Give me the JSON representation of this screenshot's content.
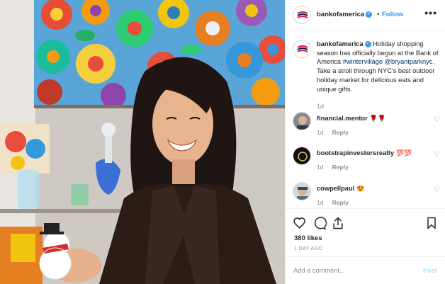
{
  "post": {
    "username": "bankofamerica",
    "follow_label": "Follow",
    "separator": "•",
    "more_label": "•••"
  },
  "caption": {
    "username": "bankofamerica",
    "text_before": " Holiday shopping season has officially begun at the Bank of America ",
    "hashtag": "#wintervillage",
    "mention": "@bryantparknyc",
    "text_after": ". Take a stroll through NYC's best outdoor holiday market for delicious eats and unique gifts.",
    "time": "1d"
  },
  "comments": [
    {
      "username": "financial.mentor",
      "emoji": "🌹🌹",
      "time": "1d",
      "reply_label": "Reply"
    },
    {
      "username": "bootstrapinvestorsrealty",
      "emoji": "💯💯",
      "time": "1d",
      "reply_label": "Reply"
    },
    {
      "username": "cowpellpaul",
      "emoji": "😍",
      "time": "1d",
      "reply_label": "Reply"
    }
  ],
  "actions": {
    "icons": [
      "heart-icon",
      "comment-icon",
      "share-icon",
      "bookmark-icon"
    ],
    "likes": "380 likes",
    "posted_ago": "1 DAY AGO"
  },
  "add_comment": {
    "placeholder": "Add a comment...",
    "post_label": "Post"
  },
  "colors": {
    "link_blue": "#3897f0",
    "muted": "#8e8e8e",
    "post_disabled": "#b2dffc",
    "brand_red": "#e31837",
    "brand_navy": "#012169"
  }
}
